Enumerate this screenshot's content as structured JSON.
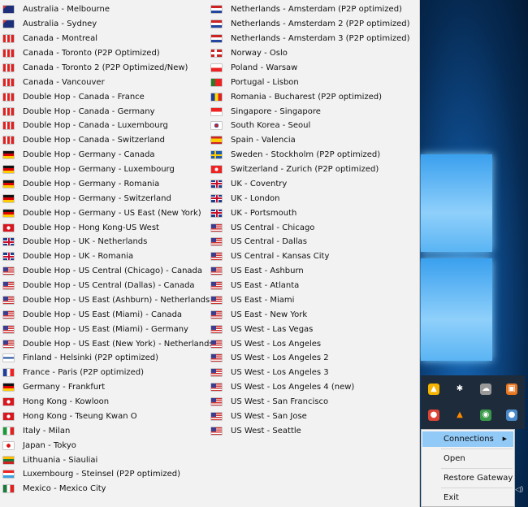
{
  "colors": {
    "menu_bg": "#f2f2f2",
    "highlight": "#91c9f7",
    "desktop": "#0e4a8a"
  },
  "server_list": {
    "column1": [
      {
        "label": "Australia - Melbourne",
        "flag": "au"
      },
      {
        "label": "Australia - Sydney",
        "flag": "au"
      },
      {
        "label": "Canada - Montreal",
        "flag": "ca"
      },
      {
        "label": "Canada - Toronto (P2P Optimized)",
        "flag": "ca"
      },
      {
        "label": "Canada - Toronto 2 (P2P Optimized/New)",
        "flag": "ca"
      },
      {
        "label": "Canada - Vancouver",
        "flag": "ca"
      },
      {
        "label": "Double Hop - Canada - France",
        "flag": "ca"
      },
      {
        "label": "Double Hop - Canada - Germany",
        "flag": "ca"
      },
      {
        "label": "Double Hop - Canada - Luxembourg",
        "flag": "ca"
      },
      {
        "label": "Double Hop - Canada - Switzerland",
        "flag": "ca"
      },
      {
        "label": "Double Hop - Germany - Canada",
        "flag": "de"
      },
      {
        "label": "Double Hop - Germany - Luxembourg",
        "flag": "de"
      },
      {
        "label": "Double Hop - Germany - Romania",
        "flag": "de"
      },
      {
        "label": "Double Hop - Germany - Switzerland",
        "flag": "de"
      },
      {
        "label": "Double Hop - Germany - US East (New York)",
        "flag": "de"
      },
      {
        "label": "Double Hop - Hong Kong-US West",
        "flag": "hk"
      },
      {
        "label": "Double Hop - UK - Netherlands",
        "flag": "uk"
      },
      {
        "label": "Double Hop - UK - Romania",
        "flag": "uk"
      },
      {
        "label": "Double Hop - US Central (Chicago) - Canada",
        "flag": "us"
      },
      {
        "label": "Double Hop - US Central (Dallas) - Canada",
        "flag": "us"
      },
      {
        "label": "Double Hop - US East (Ashburn) - Netherlands",
        "flag": "us"
      },
      {
        "label": "Double Hop - US East (Miami) - Canada",
        "flag": "us"
      },
      {
        "label": "Double Hop - US East (Miami) - Germany",
        "flag": "us"
      },
      {
        "label": "Double Hop - US East (New York) - Netherlands",
        "flag": "us"
      },
      {
        "label": "Finland - Helsinki (P2P optimized)",
        "flag": "fi"
      },
      {
        "label": "France - Paris (P2P optimized)",
        "flag": "fr"
      },
      {
        "label": "Germany - Frankfurt",
        "flag": "de"
      },
      {
        "label": "Hong Kong - Kowloon",
        "flag": "hk"
      },
      {
        "label": "Hong Kong - Tseung Kwan O",
        "flag": "hk"
      },
      {
        "label": "Italy - Milan",
        "flag": "it"
      },
      {
        "label": "Japan - Tokyo",
        "flag": "jp"
      },
      {
        "label": "Lithuania - Siauliai",
        "flag": "lt"
      },
      {
        "label": "Luxembourg - Steinsel (P2P optimized)",
        "flag": "lu"
      },
      {
        "label": "Mexico - Mexico City",
        "flag": "mx"
      }
    ],
    "column2": [
      {
        "label": "Netherlands - Amsterdam (P2P optimized)",
        "flag": "nl"
      },
      {
        "label": "Netherlands - Amsterdam 2 (P2P optimized)",
        "flag": "nl"
      },
      {
        "label": "Netherlands - Amsterdam 3 (P2P optimized)",
        "flag": "nl"
      },
      {
        "label": "Norway - Oslo",
        "flag": "no"
      },
      {
        "label": "Poland - Warsaw",
        "flag": "pl"
      },
      {
        "label": "Portugal - Lisbon",
        "flag": "pt"
      },
      {
        "label": "Romania - Bucharest (P2P optimized)",
        "flag": "ro"
      },
      {
        "label": "Singapore - Singapore",
        "flag": "sg"
      },
      {
        "label": "South Korea - Seoul",
        "flag": "kr"
      },
      {
        "label": "Spain - Valencia",
        "flag": "es"
      },
      {
        "label": "Sweden - Stockholm (P2P optimized)",
        "flag": "se"
      },
      {
        "label": "Switzerland - Zurich (P2P optimized)",
        "flag": "ch"
      },
      {
        "label": "UK - Coventry",
        "flag": "uk"
      },
      {
        "label": "UK - London",
        "flag": "uk"
      },
      {
        "label": "UK - Portsmouth",
        "flag": "uk"
      },
      {
        "label": "US Central - Chicago",
        "flag": "us"
      },
      {
        "label": "US Central - Dallas",
        "flag": "us"
      },
      {
        "label": "US Central - Kansas City",
        "flag": "us"
      },
      {
        "label": "US East - Ashburn",
        "flag": "us"
      },
      {
        "label": "US East - Atlanta",
        "flag": "us"
      },
      {
        "label": "US East - Miami",
        "flag": "us"
      },
      {
        "label": "US East - New York",
        "flag": "us"
      },
      {
        "label": "US West - Las Vegas",
        "flag": "us"
      },
      {
        "label": "US West - Los Angeles",
        "flag": "us"
      },
      {
        "label": "US West - Los Angeles 2",
        "flag": "us"
      },
      {
        "label": "US West - Los Angeles 3",
        "flag": "us"
      },
      {
        "label": "US West - Los Angeles 4 (new)",
        "flag": "us"
      },
      {
        "label": "US West - San Francisco",
        "flag": "us"
      },
      {
        "label": "US West - San Jose",
        "flag": "us"
      },
      {
        "label": "US West - Seattle",
        "flag": "us"
      }
    ]
  },
  "tray_icons": [
    "google-drive-icon",
    "bluetooth-icon",
    "cloud-icon",
    "media-icon",
    "chrome-icon",
    "vlc-icon",
    "network-app-icon",
    "gateway-icon"
  ],
  "context_menu": {
    "connections": "Connections",
    "open": "Open",
    "restore_gateway": "Restore Gateway",
    "exit": "Exit"
  }
}
